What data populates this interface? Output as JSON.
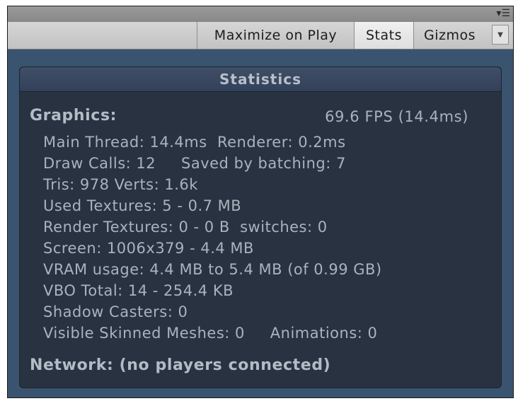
{
  "toolbar": {
    "maximize_label": "Maximize on Play",
    "stats_label": "Stats",
    "gizmos_label": "Gizmos",
    "menu_icon": "panel-menu-icon"
  },
  "stats": {
    "header": "Statistics",
    "graphics_label": "Graphics:",
    "fps": "69.6 FPS (14.4ms)",
    "lines": [
      "Main Thread: 14.4ms  Renderer: 0.2ms",
      "Draw Calls: 12     Saved by batching: 7",
      "Tris: 978 Verts: 1.6k",
      "Used Textures: 5 - 0.7 MB",
      "Render Textures: 0 - 0 B  switches: 0",
      "Screen: 1006x379 - 4.4 MB",
      "VRAM usage: 4.4 MB to 5.4 MB (of 0.99 GB)",
      "VBO Total: 14 - 254.4 KB",
      "Shadow Casters: 0",
      "Visible Skinned Meshes: 0     Animations: 0"
    ],
    "network": "Network: (no players connected)"
  },
  "colors": {
    "panel_bg": "#283240",
    "text": "#aab3bd",
    "window_bg": "#3a5470"
  }
}
